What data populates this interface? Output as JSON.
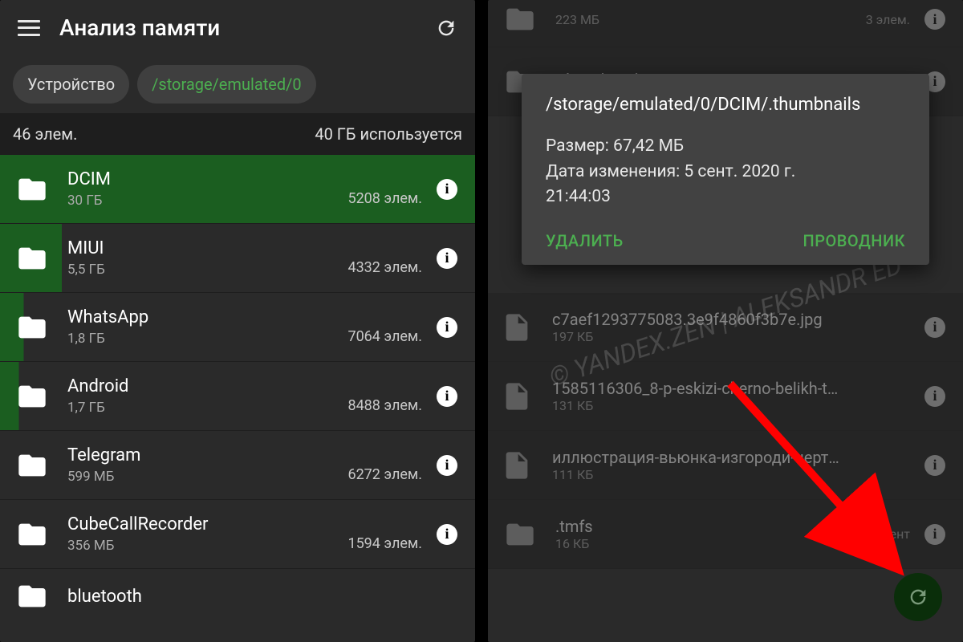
{
  "left": {
    "title": "Анализ памяти",
    "chip_device": "Устройство",
    "chip_path": "/storage/emulated/0",
    "stats_count": "46 элем.",
    "stats_used": "40 ГБ используется",
    "items": [
      {
        "name": "DCIM",
        "size": "30 ГБ",
        "count": "5208 элем."
      },
      {
        "name": "MIUI",
        "size": "5,5 ГБ",
        "count": "4332 элем."
      },
      {
        "name": "WhatsApp",
        "size": "1,8 ГБ",
        "count": "7064 элем."
      },
      {
        "name": "Android",
        "size": "1,7 ГБ",
        "count": "8488 элем."
      },
      {
        "name": "Telegram",
        "size": "599 МБ",
        "count": "6272 элем."
      },
      {
        "name": "CubeCallRecorder",
        "size": "356 МБ",
        "count": "1594 элем."
      },
      {
        "name": "bluetooth",
        "size": "",
        "count": ""
      }
    ]
  },
  "right": {
    "top_items": [
      {
        "name": "",
        "size": "223 МБ",
        "count": "3 элем."
      },
      {
        "name": ".thumbnails",
        "size": "",
        "count": ""
      }
    ],
    "dialog": {
      "path": "/storage/emulated/0/DCIM/.thumbnails",
      "size_label": "Размер:",
      "size_value": "67,42 МБ",
      "date_label": "Дата изменения:",
      "date_value": "5 сент. 2020 г.",
      "time_value": "21:44:03",
      "delete": "УДАЛИТЬ",
      "explorer": "ПРОВОДНИК"
    },
    "items": [
      {
        "name": "c7aef1293775083.3e9f4860f3b7e.jpg",
        "size": "197 КБ"
      },
      {
        "name": "1585116306_8-p-eskizi-cherno-belikh-t…",
        "size": "131 КБ"
      },
      {
        "name": "иллюстрация-вьюнка-изгороди-черт…",
        "size": "111 КБ"
      },
      {
        "name": ".tmfs",
        "size": "16 КБ",
        "count": "элемент",
        "is_folder": true
      }
    ]
  },
  "watermark": "© YANDEX.ZEN | ALEKSANDR ED"
}
